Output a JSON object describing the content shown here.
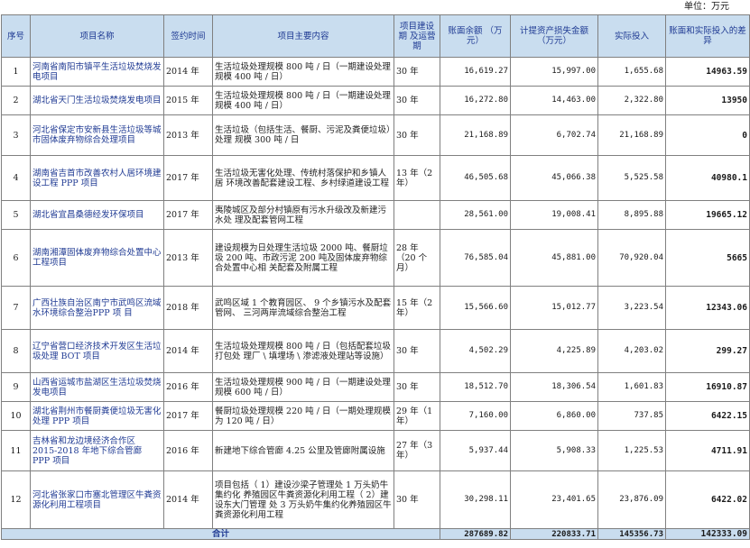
{
  "unit_label": "单位：万元",
  "headers": [
    "序号",
    "项目名称",
    "签约时间",
    "项目主要内容",
    "项目建设期 及运营期",
    "账面余额 （万元）",
    "计提资产损失金额（万元）",
    "实际投入",
    "账面和实际投入的差异"
  ],
  "rows": [
    {
      "no": "1",
      "name": "河南省南阳市镇平生活垃圾焚烧发电项目",
      "date": "2014 年",
      "content": "生活垃圾处理规模 800 吨 / 日（一期建设处理规模 400 吨 / 日）",
      "period": "30 年",
      "balance": "16,619.27",
      "provision": "15,997.00",
      "invest": "1,655.68",
      "diff": "14963.59"
    },
    {
      "no": "2",
      "name": "湖北省天门生活垃圾焚烧发电项目",
      "date": "2015 年",
      "content": "生活垃圾处理规模 800 吨 / 日（一期建设处理规模 400 吨 / 日）",
      "period": "30 年",
      "balance": "16,272.80",
      "provision": "14,463.00",
      "invest": "2,322.80",
      "diff": "13950"
    },
    {
      "no": "3",
      "name": "河北省保定市安新县生活垃圾等城市固体废弃物综合处理项目",
      "date": "2013 年",
      "content": "生活垃圾（包括生活、餐厨、污泥及粪便垃圾）处理 规模 300 吨 / 日",
      "period": "30 年",
      "balance": "21,168.89",
      "provision": "6,702.74",
      "invest": "21,168.89",
      "diff": "0"
    },
    {
      "no": "4",
      "name": "湖南省吉首市改善农村人居环境建设工程 PPP 项目",
      "date": "2017 年",
      "content": "生活垃圾无害化处理、传统村落保护和乡镇人居 环境改善配套建设工程、乡村绿道建设工程",
      "period": "13 年（2 年）",
      "balance": "46,505.68",
      "provision": "45,066.38",
      "invest": "5,525.58",
      "diff": "40980.1"
    },
    {
      "no": "5",
      "name": "湖北省宜昌桑德经发环保项目",
      "date": "2017 年",
      "content": "夷陵城区及部分村镇原有污水升级改及新建污水处 理及配套管网工程",
      "period": "",
      "balance": "28,561.00",
      "provision": "19,008.41",
      "invest": "8,895.88",
      "diff": "19665.12"
    },
    {
      "no": "6",
      "name": "湖南湘潭固体废弃物综合处置中心工程项目",
      "date": "2013 年",
      "content": "建设规模为日处理生活垃圾 2000 吨、餐厨垃圾 200 吨、市政污泥 200 吨及固体废弃物综合处置中心相 关配套及附属工程",
      "period": "28 年（20 个月）",
      "balance": "76,585.04",
      "provision": "45,881.00",
      "invest": "70,920.04",
      "diff": "5665"
    },
    {
      "no": "7",
      "name": "广西壮族自治区南宁市武鸣区流域水环境综合整治PPP 项 目",
      "date": "2018 年",
      "content": "武鸣区域 1 个教育园区、 9 个乡镇污水及配套管网、 三河两岸流域综合整治工程",
      "period": "15 年（2 年）",
      "balance": "15,566.60",
      "provision": "15,012.77",
      "invest": "3,223.54",
      "diff": "12343.06"
    },
    {
      "no": "8",
      "name": "辽宁省营口经济技术开发区生活垃圾处理 BOT 项目",
      "date": "2014 年",
      "content": "生活垃圾处理规模 800 吨 / 日（包括配套垃圾打包处 理厂 \\ 填埋场 \\ 渗滤液处理站等设施）",
      "period": "30 年",
      "balance": "4,502.29",
      "provision": "4,225.89",
      "invest": "4,203.02",
      "diff": "299.27"
    },
    {
      "no": "9",
      "name": "山西省运城市盐湖区生活垃圾焚烧发电项目",
      "date": "2016 年",
      "content": "生活垃圾处理规模 900 吨 / 日（一期建设处理规模 600 吨 / 日）",
      "period": "30 年",
      "balance": "18,512.70",
      "provision": "18,306.54",
      "invest": "1,601.83",
      "diff": "16910.87"
    },
    {
      "no": "10",
      "name": "湖北省荆州市餐厨粪便垃圾无害化处理 PPP 项目",
      "date": "2017 年",
      "content": "餐厨垃圾处理规模 220 吨 / 日（一期处理规模为 120 吨 / 日）",
      "period": "29 年（1 年）",
      "balance": "7,160.00",
      "provision": "6,860.00",
      "invest": "737.85",
      "diff": "6422.15"
    },
    {
      "no": "11",
      "name": "吉林省和龙边境经济合作区 2015-2018 年地下综合管廊 PPP 项目",
      "date": "2016 年",
      "content": "新建地下综合管廊 4.25 公里及管廊附属设施",
      "period": "27 年（3 年）",
      "balance": "5,937.44",
      "provision": "5,908.33",
      "invest": "1,225.53",
      "diff": "4711.91"
    },
    {
      "no": "12",
      "name": "河北省张家口市塞北管理区牛粪资源化利用工程项目",
      "date": "2014 年",
      "content": "项目包括（ 1）建设沙梁子管理处 1 万头奶牛集约化 养殖园区牛粪资源化利用工程（ 2）建设东大门管理 处 3 万头奶牛集约化养殖园区牛粪资源化利用工程",
      "period": "30 年",
      "balance": "30,298.11",
      "provision": "23,401.65",
      "invest": "23,876.09",
      "diff": "6422.02"
    }
  ],
  "total": {
    "label": "合计",
    "balance": "287689.82",
    "provision": "220833.71",
    "invest": "145356.73",
    "diff": "142333.09"
  }
}
